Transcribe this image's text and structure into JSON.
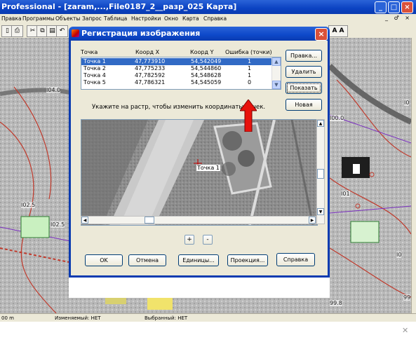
{
  "app": {
    "title": "Professional - [zaram,...,File0187_2__разр_025 Карта]",
    "menu": [
      "Правка",
      "Программы",
      "Объекты",
      "Запрос",
      "Таблица",
      "Настройки",
      "Окно",
      "Карта",
      "Справка"
    ],
    "mdi_controls": "_ ♂ ×",
    "title_controls": [
      "_",
      "□",
      "×"
    ],
    "toolbar_right_text": "A A"
  },
  "map": {
    "labels": [
      "I04.0",
      "I02.5",
      "I02.5",
      "I00.0",
      "I0",
      "I01",
      "I0",
      "99.8",
      "99"
    ]
  },
  "status": {
    "scale": "00 m",
    "editable": "Изменяемый: НЕТ",
    "selected": "Выбранный: НЕТ"
  },
  "dialog": {
    "title": "Регистрация изображения",
    "close": "×",
    "columns": [
      "Точка",
      "Коорд X",
      "Коорд Y",
      "Ошибка (точки)"
    ],
    "rows": [
      {
        "point": "Точка 1",
        "x": "47,773910",
        "y": "54,542049",
        "err": "1",
        "selected": true
      },
      {
        "point": "Точка 2",
        "x": "47,775233",
        "y": "54,544860",
        "err": "1",
        "selected": false
      },
      {
        "point": "Точка 4",
        "x": "47,782592",
        "y": "54,548628",
        "err": "1",
        "selected": false
      },
      {
        "point": "Точка 5",
        "x": "47,786321",
        "y": "54,545059",
        "err": "0",
        "selected": false
      }
    ],
    "side_buttons": {
      "edit": "Правка...",
      "delete": "Удалить",
      "show": "Показать",
      "new": "Новая"
    },
    "hint": "Укажите на растр, чтобы изменить координаты точек.",
    "photo_point_label": "Точка 1",
    "zoom_in": "+",
    "zoom_out": "-",
    "bottom_buttons": {
      "ok": "OK",
      "cancel": "Отмена",
      "units": "Единицы...",
      "projection": "Проекция...",
      "help": "Справка"
    }
  },
  "colors": {
    "title_blue": "#0a3bb0",
    "selection": "#316ac5",
    "highlight_arrow": "#e8120c"
  }
}
